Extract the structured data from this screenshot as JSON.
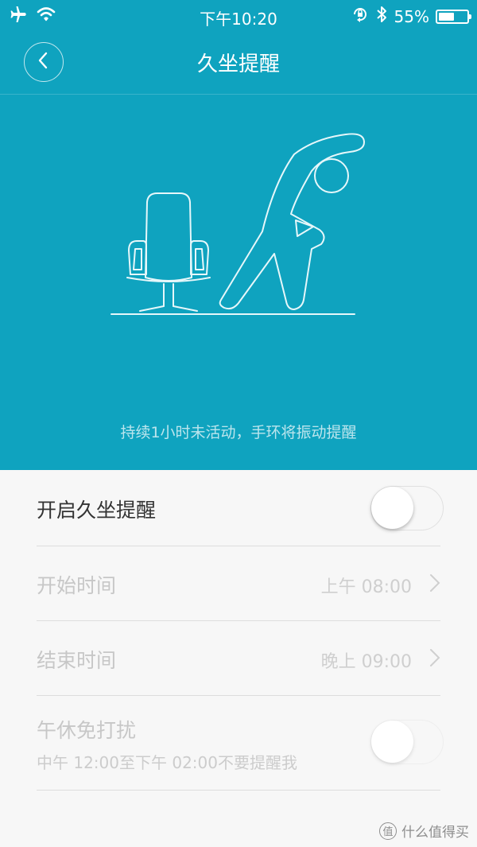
{
  "status_bar": {
    "time": "下午10:20",
    "battery_text": "55%",
    "battery_level": 0.55
  },
  "nav": {
    "title": "久坐提醒",
    "back_icon": "chevron-left-icon"
  },
  "hero": {
    "caption": "持续1小时未活动，手环将振动提醒"
  },
  "settings": {
    "enable": {
      "label": "开启久坐提醒",
      "on": false
    },
    "start": {
      "label": "开始时间",
      "value": "上午 08:00"
    },
    "end": {
      "label": "结束时间",
      "value": "晚上 09:00"
    },
    "noon": {
      "label": "午休免打扰",
      "subtitle": "中午 12:00至下午 02:00不要提醒我",
      "on": false
    }
  },
  "watermark": {
    "badge": "值",
    "text": "什么值得买"
  },
  "colors": {
    "accent": "#0fa3bf",
    "background": "#f7f7f7",
    "text": "#333333",
    "muted": "#c7c7c7"
  }
}
